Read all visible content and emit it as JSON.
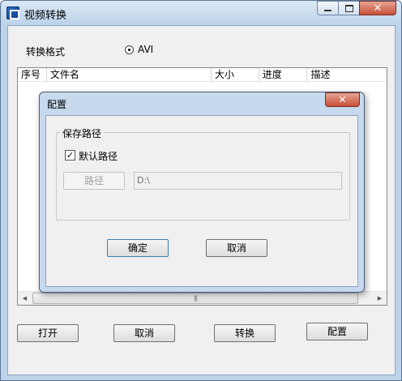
{
  "window": {
    "title": "视频转换",
    "min_glyph": "",
    "max_glyph": "",
    "close_glyph": "✕"
  },
  "format": {
    "label": "转换格式",
    "option": "AVI",
    "selected": true
  },
  "table": {
    "columns": [
      "序号",
      "文件名",
      "大小",
      "进度",
      "描述"
    ],
    "rows": [],
    "scroll_left": "◀",
    "scroll_right": "▶",
    "scroll_grip": "|||"
  },
  "buttons": {
    "open": "打开",
    "cancel": "取消",
    "convert": "转换",
    "config": "配置"
  },
  "dialog": {
    "title": "配置",
    "close_glyph": "✕",
    "group_title": "保存路径",
    "default_path_label": "默认路径",
    "default_path_checked": true,
    "check_glyph": "✓",
    "path_button": "路径",
    "path_value": "D:\\",
    "ok": "确定",
    "cancel": "取消"
  }
}
